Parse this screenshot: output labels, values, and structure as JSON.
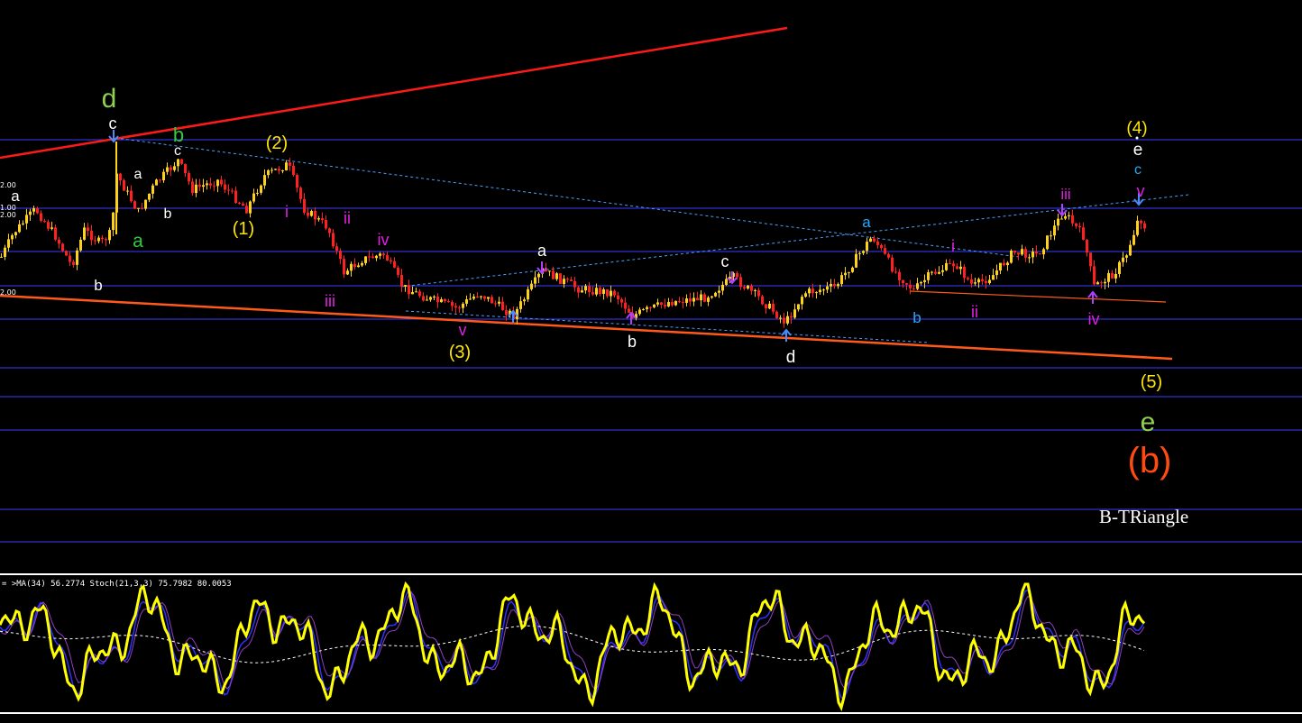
{
  "indicator": {
    "label": "= >MA(34) 56.2774  Stoch(21,3,3) 75.7982 80.0053"
  },
  "annotation_title": "B-TRiangle",
  "price_axis_fragments": [
    "2.00",
    "1.00",
    "2.00",
    "2.00"
  ],
  "colors": {
    "background": "#000000",
    "grid": "#3b3bff",
    "bull_candle": "#ffd21a",
    "bear_candle": "#ff2020",
    "upper_trend": "#ff1a1a",
    "lower_trend": "#ff5a1a",
    "channel_dotted": "#4aa0ff",
    "stoch_main": "#ffff00",
    "stoch_signal": "#3030ff",
    "ma_line": "#ffffff"
  },
  "wave_labels": [
    {
      "text": "d",
      "color": "#8fd14f"
    },
    {
      "text": "c",
      "color": "#ffffff"
    },
    {
      "text": "b",
      "color": "#2ecc40"
    },
    {
      "text": "a",
      "color": "#ffffff"
    },
    {
      "text": "b",
      "color": "#ffffff"
    },
    {
      "text": "a",
      "color": "#2ecc40"
    },
    {
      "text": "c",
      "color": "#ffffff"
    },
    {
      "text": "a",
      "color": "#ffffff"
    },
    {
      "text": "b",
      "color": "#ffffff"
    },
    {
      "text": "(1)",
      "color": "#ffe600"
    },
    {
      "text": "(2)",
      "color": "#ffe600"
    },
    {
      "text": "i",
      "color": "#e020e0"
    },
    {
      "text": "ii",
      "color": "#e020e0"
    },
    {
      "text": "iii",
      "color": "#e020e0"
    },
    {
      "text": "iv",
      "color": "#e020e0"
    },
    {
      "text": "v",
      "color": "#e020e0"
    },
    {
      "text": "(3)",
      "color": "#ffe600"
    },
    {
      "text": "a",
      "color": "#ffffff"
    },
    {
      "text": "b",
      "color": "#ffffff"
    },
    {
      "text": "c",
      "color": "#ffffff"
    },
    {
      "text": "d",
      "color": "#ffffff"
    },
    {
      "text": "a",
      "color": "#29a8ff"
    },
    {
      "text": "b",
      "color": "#29a8ff"
    },
    {
      "text": "i",
      "color": "#e020e0"
    },
    {
      "text": "ii",
      "color": "#e020e0"
    },
    {
      "text": "iii",
      "color": "#e020e0"
    },
    {
      "text": "iv",
      "color": "#e020e0"
    },
    {
      "text": "(4)",
      "color": "#ffe600"
    },
    {
      "text": "e",
      "color": "#ffffff"
    },
    {
      "text": "c",
      "color": "#29a8ff"
    },
    {
      "text": "v",
      "color": "#e020e0"
    },
    {
      "text": "(5)",
      "color": "#ffe600"
    },
    {
      "text": "e",
      "color": "#8fd14f"
    },
    {
      "text": "(b)",
      "color": "#ff4a10"
    }
  ],
  "chart_data": {
    "type": "candlestick",
    "title": "",
    "series": [
      {
        "name": "price"
      },
      {
        "name": "Stoch(21,3,3)",
        "values": [
          75.7982,
          80.0053
        ]
      },
      {
        "name": "MA(34)",
        "values": [
          56.2774
        ]
      }
    ],
    "grid": true,
    "horizontal_levels": 11
  }
}
